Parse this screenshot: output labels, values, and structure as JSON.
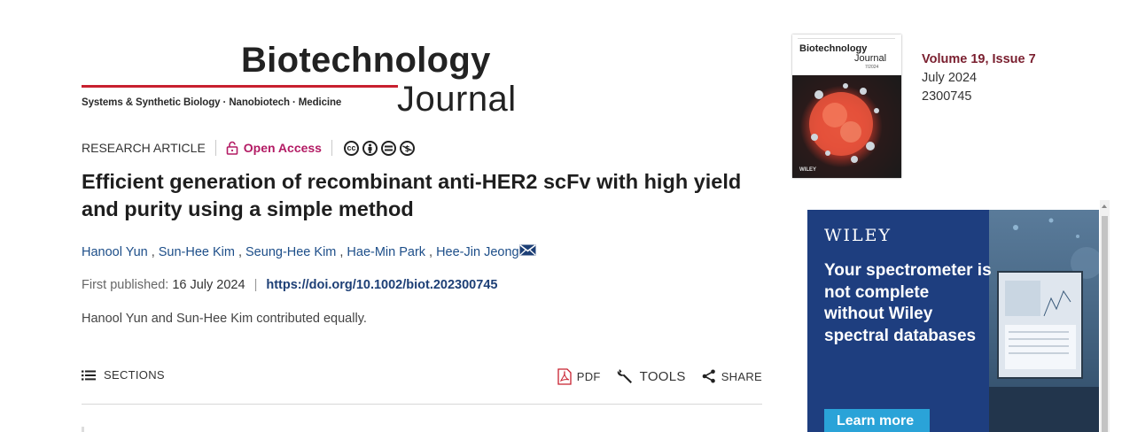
{
  "journal": {
    "name_top": "Biotechnology",
    "subtitle": "Systems & Synthetic Biology · Nanobiotech · Medicine",
    "name_bottom": "Journal"
  },
  "article": {
    "type": "RESEARCH ARTICLE",
    "access": "Open Access",
    "license_icons": [
      "cc-icon",
      "by-icon",
      "nd-icon",
      "nc-icon"
    ],
    "title": "Efficient generation of recombinant anti-HER2 scFv with high yield and purity using a simple method",
    "authors": [
      "Hanool Yun",
      "Sun-Hee Kim",
      "Seung-Hee Kim",
      "Hae-Min Park",
      "Hee-Jin Jeong"
    ],
    "first_published_label": "First published:",
    "first_published_date": "16 July 2024",
    "doi": "https://doi.org/10.1002/biot.202300745",
    "note": "Hanool Yun and Sun-Hee Kim contributed equally."
  },
  "toolbar": {
    "sections": "SECTIONS",
    "pdf": "PDF",
    "tools": "TOOLS",
    "share": "SHARE"
  },
  "issue": {
    "cover_title_top": "Biotechnology",
    "cover_title_bottom": "Journal",
    "cover_issue": "7/2024",
    "cover_publisher": "WILEY",
    "volume": "Volume 19, Issue 7",
    "date": "July 2024",
    "number": "2300745"
  },
  "ad": {
    "brand": "WILEY",
    "headline": "Your spectrometer is not complete without Wiley spectral databases",
    "cta": "Learn more"
  },
  "colors": {
    "accent_red": "#c8202f",
    "open_access": "#b31b64",
    "link_blue": "#1d4e89",
    "volume": "#7a1f2f",
    "ad_bg": "#1e3e7f",
    "ad_button": "#2aa3d8"
  }
}
